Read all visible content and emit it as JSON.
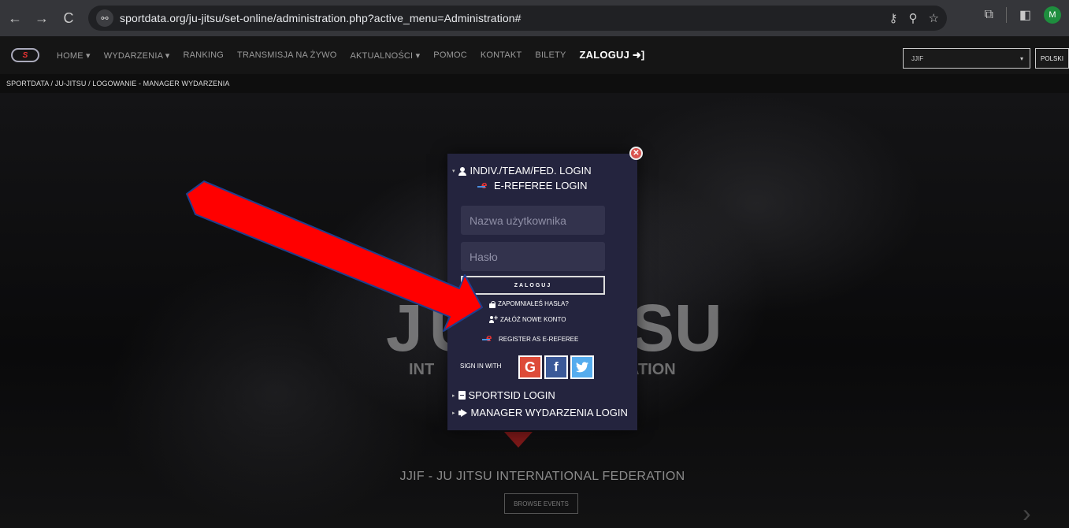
{
  "browser": {
    "url": "sportdata.org/ju-jitsu/set-online/administration.php?active_menu=Administration#",
    "avatar_letter": "M",
    "back_glyph": "←",
    "forward_glyph": "→",
    "reload_glyph": "C",
    "site_info_glyph": "⚯",
    "key_glyph": "⚷",
    "zoom_glyph": "⚲",
    "star_glyph": "☆",
    "extensions_glyph": "⧉",
    "sidepanel_glyph": "◧"
  },
  "site_nav": {
    "logo_text": "S",
    "items": [
      {
        "label": "HOME ▾"
      },
      {
        "label": "WYDARZENIA ▾"
      },
      {
        "label": "RANKING"
      },
      {
        "label": "TRANSMISJA NA ŻYWO"
      },
      {
        "label": "AKTUALNOŚCI ▾"
      },
      {
        "label": "POMOC"
      },
      {
        "label": "KONTAKT"
      },
      {
        "label": "BILETY"
      }
    ],
    "login_label": "ZALOGUJ ➜]",
    "org_select_value": "JJIF",
    "org_select_caret": "▾",
    "language": "POLSKI"
  },
  "breadcrumb": "SPORTDATA /  JU-JITSU /  LOGOWANIE - MANAGER WYDARZENIA",
  "hero": {
    "big_left": "JU",
    "big_right": "SU",
    "sub_left": "INT",
    "sub_right": "ATION",
    "federation_title": "JJIF - JU JITSU INTERNATIONAL FEDERATION",
    "browse_label": "BROWSE EVENTS",
    "next_glyph": "›"
  },
  "login_modal": {
    "close_glyph": "✕",
    "section_caret_open": "▾",
    "section_caret_closed": "▸",
    "indiv_login_title": "INDIV./TEAM/FED. LOGIN",
    "ereferee_login_title": "E-REFEREE LOGIN",
    "username_placeholder": "Nazwa użytkownika",
    "password_placeholder": "Hasło",
    "submit_label": "ZALOGUJ",
    "forgot_password": "ZAPOMNIAŁEŚ HASŁA?",
    "create_account": "ZAŁÓŻ NOWE KONTO",
    "register_ereferee": "REGISTER AS E-REFEREE",
    "sign_in_with": "SIGN IN WITH",
    "google_glyph": "G",
    "facebook_glyph": "f",
    "twitter_glyph": "🐦",
    "sportsid_login": "SPORTSID LOGIN",
    "manager_login": "MANAGER WYDARZENIA LOGIN"
  },
  "colors": {
    "modal_bg": "#24243e",
    "annotation_arrow": "#ff0000",
    "google": "#dd4b39",
    "facebook": "#3b5998",
    "twitter": "#55acee"
  }
}
